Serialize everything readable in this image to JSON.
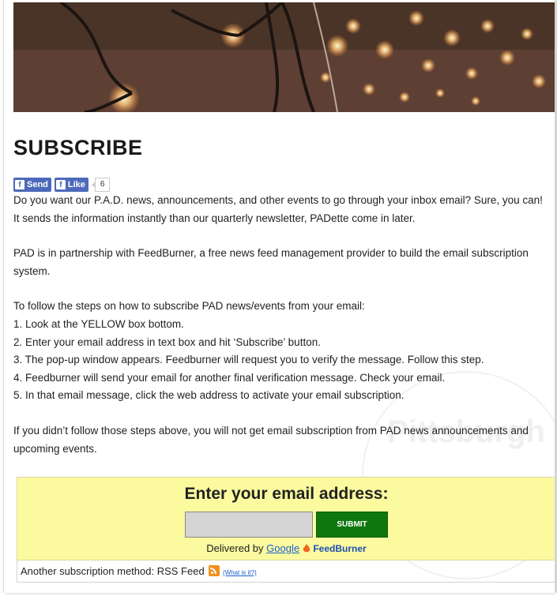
{
  "heading": "SUBSCRIBE",
  "social": {
    "send_label": "Send",
    "like_label": "Like",
    "like_count": "6"
  },
  "intro": [
    "Do you want our P.A.D. news, announcements, and other events to go through your inbox email? Sure, you can! It sends the information instantly than our quarterly newsletter, PADette come in later.",
    "PAD is in partnership with FeedBurner, a free news feed management provider to build the email subscription system."
  ],
  "steps_intro": "To follow the steps on how to subscribe PAD news/events from your email:",
  "steps": [
    "1. Look at the YELLOW box bottom.",
    "2. Enter your email address in text box and hit ‘Subscribe’ button.",
    "3. The pop-up window appears. Feedburner will request you to verify the message. Follow this step.",
    "4. Feedburner will send your email for another final verification message. Check your email.",
    "5. In that email message, click the web address to activate your email subscription."
  ],
  "closing": "If you didn’t follow those steps above, you will not get email subscription from PAD news announcements and upcoming events.",
  "subscribe_box": {
    "heading": "Enter your email address:",
    "email_value": "",
    "submit_label": "SUBMIT",
    "delivered_by": "Delivered by",
    "google_label": "Google",
    "feedburner_label": "FeedBurner",
    "bg_color": "#fbfa9f",
    "button_color": "#10770f"
  },
  "rss": {
    "label": "Another subscription method: RSS Feed",
    "what_link": "(What is it?)"
  },
  "watermark_text": "Pittsburgh"
}
